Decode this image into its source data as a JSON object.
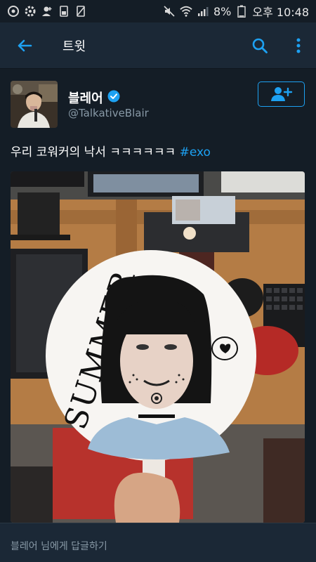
{
  "status_bar": {
    "battery": "8%",
    "time": "오후 10:48",
    "left_icons": [
      "chat-icon",
      "settings-icon",
      "add-user-icon",
      "storage-icon",
      "no-sim-icon"
    ],
    "right_icons": [
      "mute-icon",
      "wifi-icon",
      "signal-icon",
      "battery-icon"
    ]
  },
  "app_bar": {
    "title": "트윗",
    "accent": "#1da1f2"
  },
  "tweet": {
    "display_name": "블레어",
    "handle": "@TalkativeBlair",
    "text": "우리 코워커의 낙서 ㅋㅋㅋㅋㅋㅋ",
    "hashtag": "#exo",
    "verified": true,
    "media_text": "SUMMER"
  },
  "reply": {
    "placeholder": "블레어 님에게 답글하기"
  },
  "colors": {
    "background": "#141d26",
    "bar": "#1b2836",
    "accent": "#1da1f2",
    "secondary_text": "#8899a6"
  }
}
